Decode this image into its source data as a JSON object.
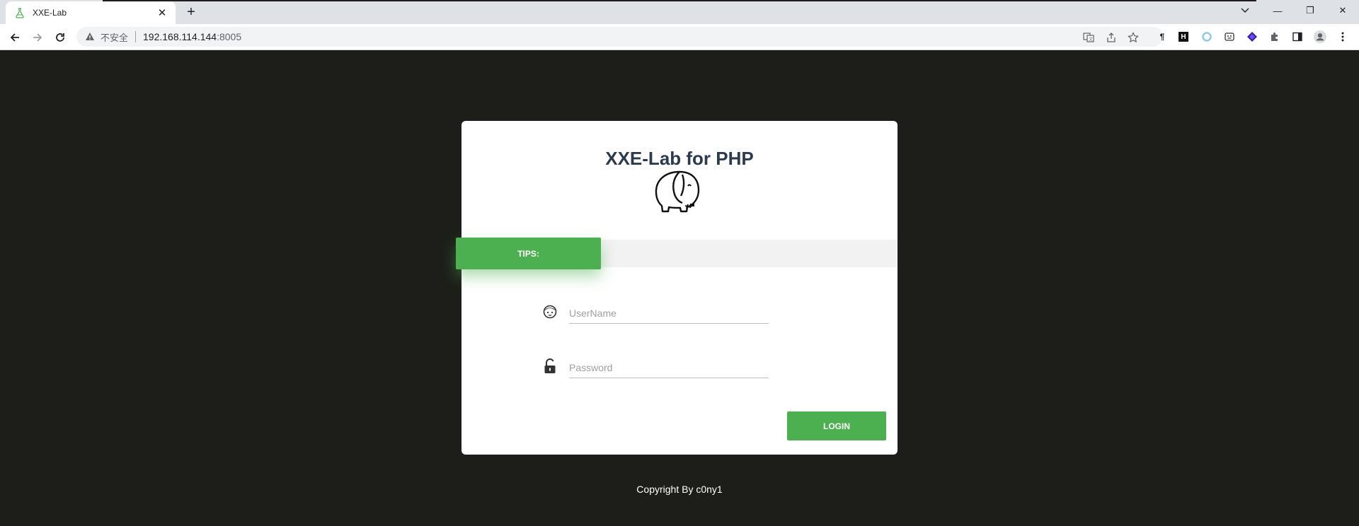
{
  "browser": {
    "tab_title": "XXE-Lab",
    "tab_close": "✕",
    "new_tab": "+",
    "window_controls": {
      "minimize": "—",
      "maximize": "❐",
      "close": "✕"
    },
    "address": {
      "security_label": "不安全",
      "host": "192.168.114.144",
      "port": ":8005"
    },
    "extension_letters": {
      "notes": "¶",
      "h_ext": "H"
    }
  },
  "page": {
    "title": "XXE-Lab for PHP",
    "tips_label": "TIPS:",
    "username_placeholder": "UserName",
    "password_placeholder": "Password",
    "login_label": "LOGIN",
    "copyright": "Copyright By c0ny1"
  },
  "colors": {
    "page_background": "#1d1e19",
    "accent_green": "#4caf50",
    "title_color": "#2c3a4f"
  }
}
